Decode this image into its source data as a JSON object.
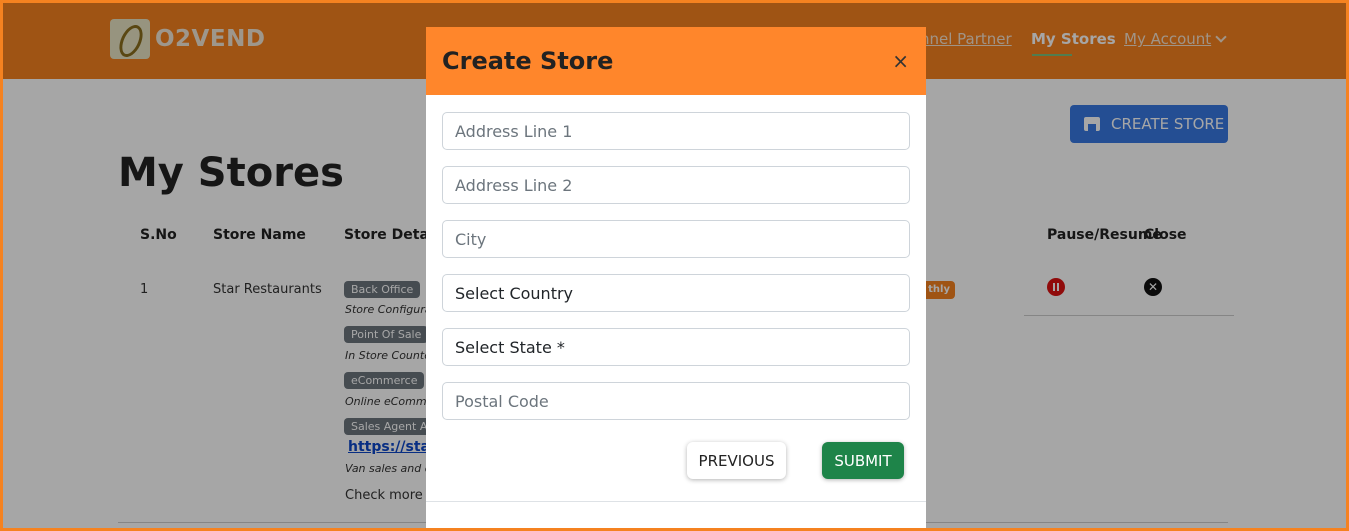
{
  "navbar": {
    "brand": "O2VEND",
    "links": {
      "partner": "nnel Partner",
      "stores": "My Stores",
      "account": "My Account"
    }
  },
  "page": {
    "title": "My Stores",
    "create_button": "CREATE STORE",
    "table": {
      "headers": [
        "S.No",
        "Store Name",
        "Store Details",
        "Pause/Resume",
        "Close"
      ],
      "row": {
        "sno": "1",
        "store_name": "Star Restaurants",
        "badges": [
          "Back Office",
          "Point Of Sale",
          "eCommerce",
          "Sales Agent App"
        ],
        "notes": [
          "Store Configurat",
          "In Store Counter",
          "Online eComme",
          "Van sales and co"
        ],
        "link": "https://starr",
        "more": "Check more d",
        "plan": "thly"
      }
    }
  },
  "modal": {
    "title": "Create Store",
    "close_symbol": "×",
    "fields": {
      "address1_placeholder": "Address Line 1",
      "address2_placeholder": "Address Line 2",
      "city_placeholder": "City",
      "country_value": "Select Country",
      "state_value": "Select State *",
      "postal_placeholder": "Postal Code"
    },
    "buttons": {
      "previous": "PREVIOUS",
      "submit": "SUBMIT"
    }
  },
  "colors": {
    "brand_orange": "#f58220",
    "modal_header": "#ff862b",
    "primary_blue": "#3878e2",
    "submit_green": "#1e8449",
    "danger_red": "#dd1111"
  },
  "icons": [
    "logo-icon",
    "store-icon",
    "chevron-down-icon",
    "pause-icon",
    "close-circle-icon",
    "close-icon"
  ]
}
